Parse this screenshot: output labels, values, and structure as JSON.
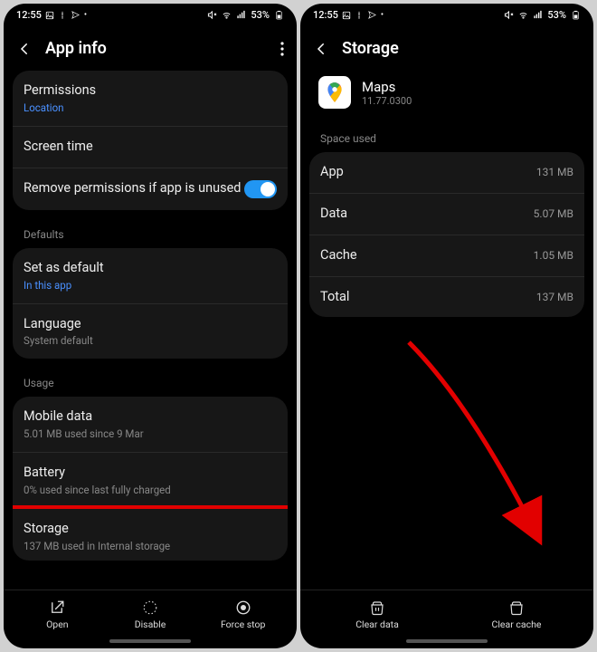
{
  "status": {
    "time": "12:55",
    "battery": "53%"
  },
  "left": {
    "title": "App info",
    "permissions": {
      "title": "Permissions",
      "sub": "Location"
    },
    "screenTime": {
      "title": "Screen time"
    },
    "removePerms": {
      "title": "Remove permissions if app is unused"
    },
    "defaultsLabel": "Defaults",
    "setDefault": {
      "title": "Set as default",
      "sub": "In this app"
    },
    "language": {
      "title": "Language",
      "sub": "System default"
    },
    "usageLabel": "Usage",
    "mobileData": {
      "title": "Mobile data",
      "sub": "5.01 MB used since 9 Mar"
    },
    "battery": {
      "title": "Battery",
      "sub": "0% used since last fully charged"
    },
    "storage": {
      "title": "Storage",
      "sub": "137 MB used in Internal storage"
    },
    "bottom": {
      "open": "Open",
      "disable": "Disable",
      "forceStop": "Force stop"
    }
  },
  "right": {
    "title": "Storage",
    "app": {
      "name": "Maps",
      "version": "11.77.0300"
    },
    "spaceLabel": "Space used",
    "rows": {
      "app": {
        "label": "App",
        "value": "131 MB"
      },
      "data": {
        "label": "Data",
        "value": "5.07 MB"
      },
      "cache": {
        "label": "Cache",
        "value": "1.05 MB"
      },
      "total": {
        "label": "Total",
        "value": "137 MB"
      }
    },
    "bottom": {
      "clearData": "Clear data",
      "clearCache": "Clear cache"
    }
  }
}
